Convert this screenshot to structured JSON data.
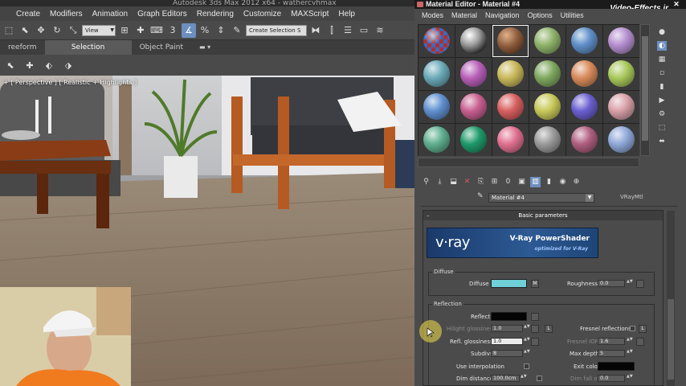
{
  "app_title": "Autodesk 3ds Max 2012 x64 - wathercvhmax",
  "menubar": [
    "Create",
    "Modifiers",
    "Animation",
    "Graph Editors",
    "Rendering",
    "Customize",
    "MAXScript",
    "Help"
  ],
  "toolbar": {
    "view_select": "View",
    "selection_set": "Create Selection S"
  },
  "ribbon_tabs": [
    "reeform",
    "Selection",
    "Object Paint"
  ],
  "viewport_label": "+ [ Perspective ] [ Realistic + Highlights ]",
  "material_editor": {
    "title": "Material Editor - Material #4",
    "watermark": "Video-Effects.ir",
    "menubar": [
      "Modes",
      "Material",
      "Navigation",
      "Options",
      "Utilities"
    ],
    "slots": [
      {
        "color": "#b03030",
        "type": "checker"
      },
      {
        "color": "#9a9a9a",
        "type": "chrome"
      },
      {
        "color": "#8a5a3a",
        "type": "wood"
      },
      {
        "color": "#8fb36a"
      },
      {
        "color": "#5f8fc8"
      },
      {
        "color": "#b58fd0"
      },
      {
        "color": "#6aaab8"
      },
      {
        "color": "#b85fb8"
      },
      {
        "color": "#c8b85a"
      },
      {
        "color": "#7fa85f"
      },
      {
        "color": "#d88a5a"
      },
      {
        "color": "#a8c85a"
      },
      {
        "color": "#5f8fcf"
      },
      {
        "color": "#c85f8f"
      },
      {
        "color": "#d85f5f"
      },
      {
        "color": "#c8c85a"
      },
      {
        "color": "#6a5fcf"
      },
      {
        "color": "#d8a0a8"
      },
      {
        "color": "#5fae8f"
      },
      {
        "color": "#1f9a6a"
      },
      {
        "color": "#e07090"
      },
      {
        "color": "#9a9a9a"
      },
      {
        "color": "#b05f80"
      },
      {
        "color": "#8fa8d8"
      }
    ],
    "selected_slot": 2,
    "material_name": "Material #4",
    "material_type": "VRayMtl",
    "rollout_title": "Basic parameters",
    "banner": {
      "logo": "v·ray",
      "title": "V-Ray PowerShader",
      "subtitle": "optimized for V-Ray"
    },
    "diffuse": {
      "group": "Diffuse",
      "label": "Diffuse",
      "color": "#6fd0d8",
      "map_button": "M",
      "roughness_label": "Roughness",
      "roughness": "0.0"
    },
    "reflection": {
      "group": "Reflection",
      "reflect_label": "Reflect",
      "reflect_color": "#050505",
      "hilight_label": "Hilight glossiness",
      "hilight_value": "1.0",
      "lock_button": "L",
      "fresnel_label": "Fresnel reflections",
      "fresnel_lock": "L",
      "refl_gloss_label": "Refl. glossiness",
      "refl_gloss_value": "1.0",
      "fresnel_ior_label": "Fresnel IOR",
      "fresnel_ior_value": "1.6",
      "subdivs_label": "Subdivs",
      "subdivs_value": "8",
      "max_depth_label": "Max depth",
      "max_depth_value": "5",
      "use_interp_label": "Use interpolation",
      "exit_color_label": "Exit color",
      "exit_color": "#050505",
      "dim_distance_label": "Dim distance",
      "dim_distance_value": "100.0cm",
      "dim_falloff_label": "Dim fall off",
      "dim_falloff_value": "0.0"
    }
  }
}
